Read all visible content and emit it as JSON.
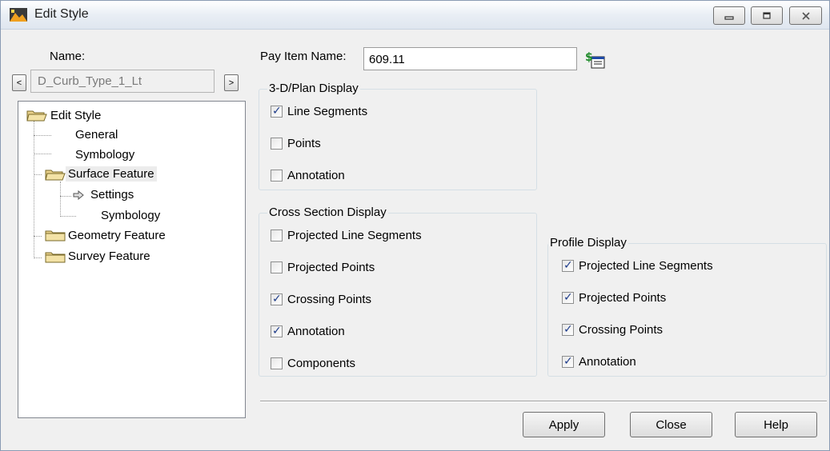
{
  "window": {
    "title": "Edit Style",
    "controls": {
      "minimize": "minimize",
      "maximize": "maximize",
      "close": "close"
    }
  },
  "name": {
    "label": "Name:",
    "value": "D_Curb_Type_1_Lt",
    "prev": "<",
    "next": ">"
  },
  "tree": {
    "root": "Edit Style",
    "general": "General",
    "symbology": "Symbology",
    "surface_feature": "Surface Feature",
    "settings": "Settings",
    "surface_symbology": "Symbology",
    "geometry_feature": "Geometry Feature",
    "survey_feature": "Survey Feature"
  },
  "pay_item": {
    "label": "Pay Item Name:",
    "value": "609.11"
  },
  "plan_display": {
    "title": "3-D/Plan Display",
    "items": [
      {
        "label": "Line Segments",
        "checked": true
      },
      {
        "label": "Points",
        "checked": false
      },
      {
        "label": "Annotation",
        "checked": false
      }
    ]
  },
  "cross_section_display": {
    "title": "Cross Section Display",
    "items": [
      {
        "label": "Projected Line Segments",
        "checked": false
      },
      {
        "label": "Projected Points",
        "checked": false
      },
      {
        "label": "Crossing Points",
        "checked": true
      },
      {
        "label": "Annotation",
        "checked": true
      },
      {
        "label": "Components",
        "checked": false
      }
    ]
  },
  "profile_display": {
    "title": "Profile Display",
    "items": [
      {
        "label": "Projected Line Segments",
        "checked": true
      },
      {
        "label": "Projected Points",
        "checked": true
      },
      {
        "label": "Crossing Points",
        "checked": true
      },
      {
        "label": "Annotation",
        "checked": true
      }
    ]
  },
  "buttons": {
    "apply": "Apply",
    "close": "Close",
    "help": "Help"
  }
}
